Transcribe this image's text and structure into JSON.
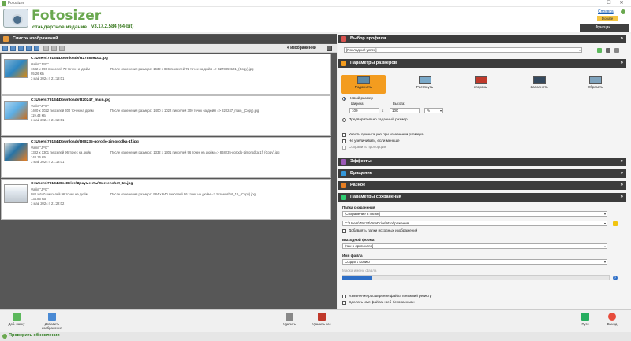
{
  "window": {
    "title": "Fotosizer",
    "minimize": "—",
    "maximize": "☐",
    "close": "✕"
  },
  "header": {
    "app_name": "Fotosizer",
    "edition": "стандартное издание",
    "version": "v3.17.2.584   (64-bit)",
    "support_label": "Справка",
    "donate_label": "Donate",
    "functions_label": "Функции..."
  },
  "image_list": {
    "title": "Список изображений",
    "count_label": "4 изображений",
    "items": [
      {
        "path": "C:\\Users\\79134\\Downloads\\6278859101.jpg",
        "type": "Файл \"JPG\"",
        "dims": "1632 x 896 пикселей 72 точек на дюйм",
        "size": "95.26 КБ",
        "date": "3 май 2024 г. 21:18:01",
        "note": "После изменения размера: 1632 x 896 пикселей 72 точек на дюйм => 6278859101_(Copy).jpg"
      },
      {
        "path": "C:\\Users\\79134\\Downloads\\820247_main.jpg",
        "type": "Файл \"JPG\"",
        "dims": "1400 x 1022 пикселей 300 точек на дюйм",
        "size": "119.43 КБ",
        "date": "3 май 2024 г. 21:18:01",
        "note": "После изменения размера: 1400 x 1022 пикселей 300 точек на дюйм => 820247_main_(Copy).jpg"
      },
      {
        "path": "C:\\Users\\79134\\Downloads\\868235-gorodo-zimorodka-1f.jpg",
        "type": "Файл \"JPG\"",
        "dims": "1332 x 1301 пикселей 96 точек на дюйм",
        "size": "148.16 КБ",
        "date": "3 май 2024 г. 21:18:01",
        "note": "После изменения размера: 1332 x 1301 пикселей 96 точек на дюйм => 868235-gorodo-zimorodka-1f_(Copy).jpg"
      },
      {
        "path": "C:\\Users\\79134\\OneDrive\\Документы\\Screenshot_16.jpg",
        "type": "Файл \"JPG\"",
        "dims": "984 x 640 пикселей 96 точек на дюйм",
        "size": "134.86 КБ",
        "date": "3 май 2024 г. 21:22:02",
        "note": "После изменения размера: 984 x 640 пикселей 96 точек на дюйм => Screenshot_16_(Copy).jpg"
      }
    ]
  },
  "profile": {
    "title": "Выбор профиля",
    "value": "[Последний успех]"
  },
  "size_params": {
    "title": "Параметры размеров",
    "tabs": [
      "Подогнать",
      "Растянуть",
      "стороны",
      "Заполнить",
      "Обрезать"
    ],
    "new_size_label": "Новый размер",
    "width_label": "Ширина:",
    "height_label": "Высота:",
    "width_value": "100",
    "height_value": "100",
    "unit_value": "%",
    "x_sign": "x",
    "preset_label": "Предварительно заданный размер",
    "orientation_label": "Учесть ориентацию при изменении размера",
    "no_enlarge_label": "Не увеличивать, если меньше",
    "keep_proportions_label": "Сохранить пропорции"
  },
  "sections": {
    "effects": "Эффекты",
    "rotation": "Вращение",
    "rename": "Разное",
    "save_params": "Параметры сохранения"
  },
  "save": {
    "folder_label": "Папка сохранения",
    "folder_mode": "[Сохранение в папке]",
    "folder_path": "C:\\Users\\79134\\OneDrive\\Изображения",
    "add_subfolders_label": "Добавлять папки исходных изображений",
    "format_label": "Выходной формат",
    "format_value": "[Как в оригинале]",
    "filename_label": "Имя файла",
    "filename_value": "Создать Копию",
    "mask_label": "Маска имени файла",
    "progress": 0.11,
    "lowercase_label": "Изменение расширения файла в нижний регистр",
    "websafe_label": "Сделать имя файла «веб-безопасным»"
  },
  "bottom": {
    "add_file": "Доб. папку",
    "add_images": "Добавить изображения",
    "remove": "Удалить",
    "remove_all": "Удалить все",
    "start": "Пуск",
    "exit": "Выход",
    "check_updates": "Проверить обновления"
  }
}
